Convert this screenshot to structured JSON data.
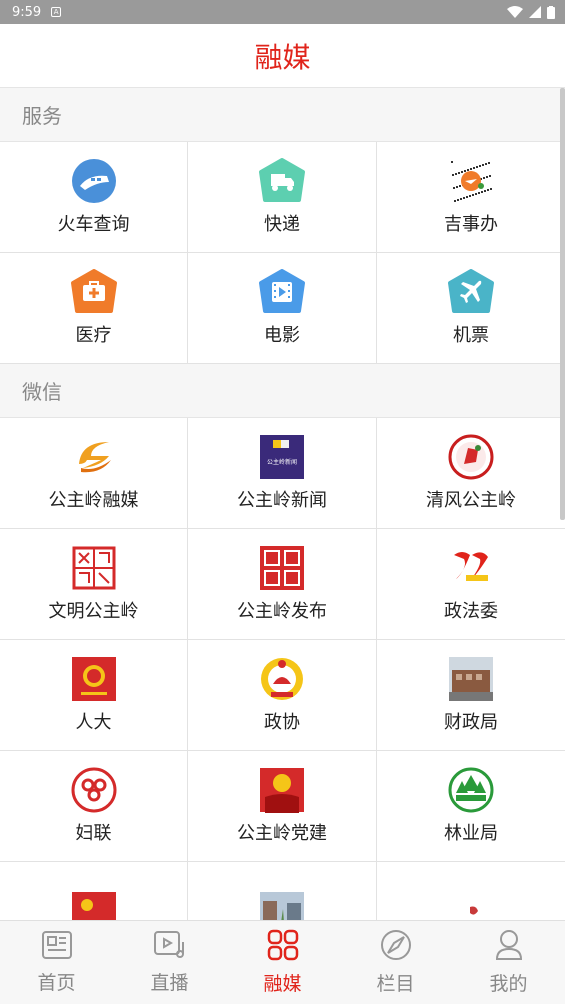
{
  "status": {
    "time": "9:59"
  },
  "header": {
    "title": "融媒"
  },
  "sections": [
    {
      "title": "服务",
      "items": [
        {
          "label": "火车查询",
          "icon": "train-icon",
          "color": "#4a90d9"
        },
        {
          "label": "快递",
          "icon": "delivery-truck-icon",
          "color": "#5dcfb0"
        },
        {
          "label": "吉事办",
          "icon": "jishiban-logo-icon",
          "color": "#f07b2a"
        },
        {
          "label": "医疗",
          "icon": "medical-kit-icon",
          "color": "#f07b2a"
        },
        {
          "label": "电影",
          "icon": "film-icon",
          "color": "#4a9be8"
        },
        {
          "label": "机票",
          "icon": "airplane-icon",
          "color": "#4ab4c8"
        }
      ]
    },
    {
      "title": "微信",
      "items": [
        {
          "label": "公主岭融媒",
          "icon": "gzl-rongmei-logo-icon",
          "color": "#e8a020"
        },
        {
          "label": "公主岭新闻",
          "icon": "gzl-news-logo-icon",
          "color": "#3a2a7a"
        },
        {
          "label": "清风公主岭",
          "icon": "qingfeng-logo-icon",
          "color": "#c81e1e"
        },
        {
          "label": "文明公主岭",
          "icon": "wenming-seal-icon",
          "color": "#d42a2a"
        },
        {
          "label": "公主岭发布",
          "icon": "fabu-seal-icon",
          "color": "#d42a2a"
        },
        {
          "label": "政法委",
          "icon": "zhengfawei-logo-icon",
          "color": "#e0241b"
        },
        {
          "label": "人大",
          "icon": "renda-emblem-icon",
          "color": "#d42a2a"
        },
        {
          "label": "政协",
          "icon": "zhengxie-emblem-icon",
          "color": "#d42a2a"
        },
        {
          "label": "财政局",
          "icon": "finance-building-photo-icon",
          "color": "#8a5a40"
        },
        {
          "label": "妇联",
          "icon": "fulian-logo-icon",
          "color": "#d42a2a"
        },
        {
          "label": "公主岭党建",
          "icon": "party-building-logo-icon",
          "color": "#d42a2a"
        },
        {
          "label": "林业局",
          "icon": "forestry-logo-icon",
          "color": "#2a9a3a"
        },
        {
          "label": "",
          "icon": "party-flag-icon",
          "color": "#d42a2a"
        },
        {
          "label": "",
          "icon": "street-photo-icon",
          "color": "#6a7a8a"
        },
        {
          "label": "",
          "icon": "seal-logo-icon",
          "color": "#c83a3a"
        }
      ]
    }
  ],
  "tabs": [
    {
      "label": "首页",
      "icon": "home-news-icon"
    },
    {
      "label": "直播",
      "icon": "live-video-icon"
    },
    {
      "label": "融媒",
      "icon": "grid-rongmei-icon",
      "active": true
    },
    {
      "label": "栏目",
      "icon": "compass-icon"
    },
    {
      "label": "我的",
      "icon": "user-icon"
    }
  ],
  "colors": {
    "accent": "#e0241b"
  }
}
